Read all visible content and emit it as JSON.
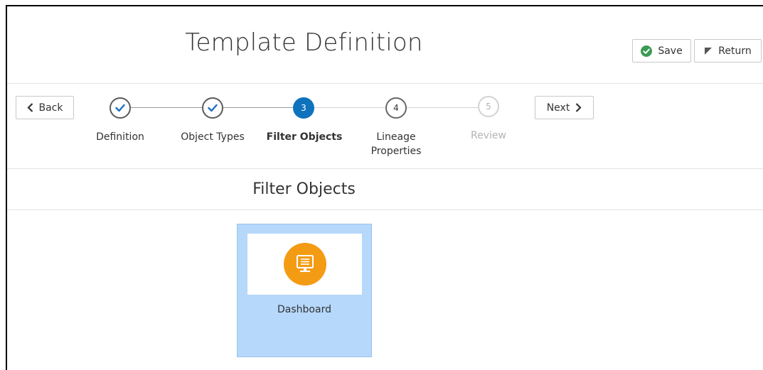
{
  "header": {
    "title": "Template Definition",
    "save_label": "Save",
    "return_label": "Return"
  },
  "wizard": {
    "back_label": "Back",
    "next_label": "Next",
    "steps": [
      {
        "number": "1",
        "label": "Definition",
        "state": "completed"
      },
      {
        "number": "2",
        "label": "Object Types",
        "state": "completed"
      },
      {
        "number": "3",
        "label": "Filter Objects",
        "state": "current"
      },
      {
        "number": "4",
        "label": "Lineage Properties",
        "state": "upcoming"
      },
      {
        "number": "5",
        "label": "Review",
        "state": "disabled"
      }
    ]
  },
  "section": {
    "title": "Filter Objects"
  },
  "cards": [
    {
      "label": "Dashboard",
      "icon": "dashboard-monitor-icon",
      "selected": true
    }
  ],
  "colors": {
    "accent": "#0f72bd",
    "save_check": "#3c9b55",
    "card_selected_bg": "#b5d8fb",
    "dashboard_icon_bg": "#f49b14"
  }
}
